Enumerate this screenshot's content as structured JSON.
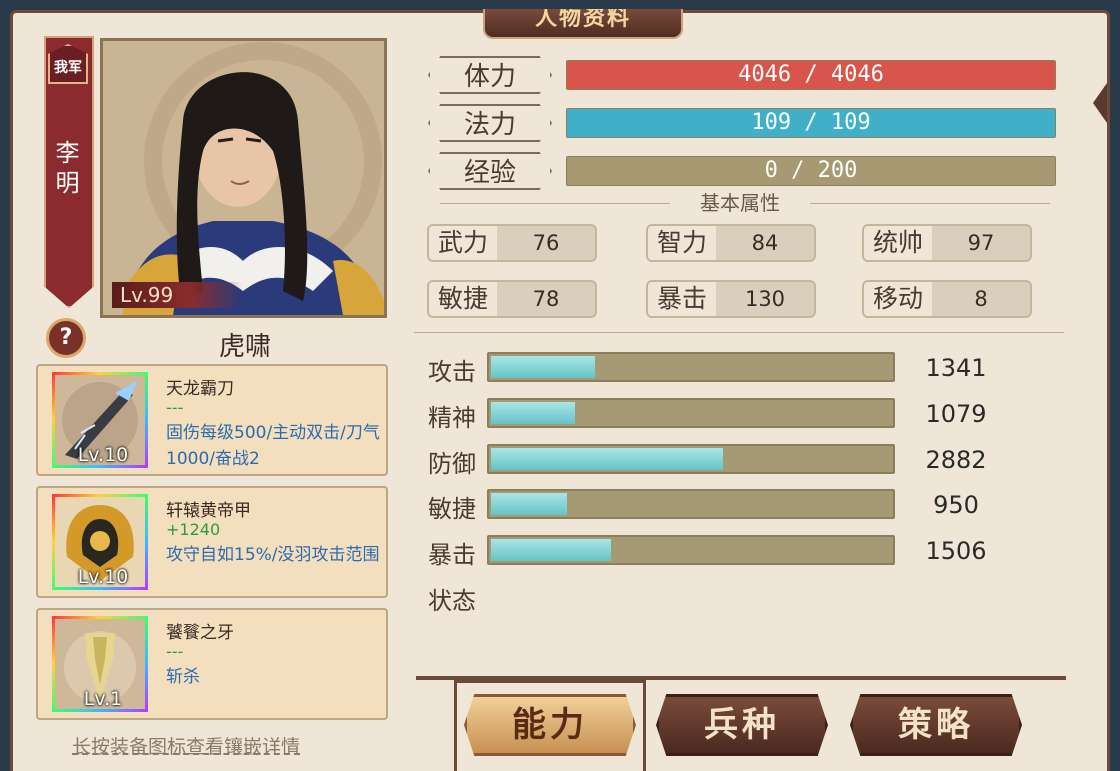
{
  "window": {
    "title": "人物资料"
  },
  "character": {
    "faction": "我军",
    "name": "李明",
    "level": "Lv.99",
    "skill": "虎啸"
  },
  "help": "?",
  "bars": [
    {
      "label": "体力",
      "value": "4046 / 4046",
      "fraction": 1.0,
      "color": "#d9554b"
    },
    {
      "label": "法力",
      "value": "109 / 109",
      "fraction": 1.0,
      "color": "#3fb0c8"
    },
    {
      "label": "经验",
      "value": "0 / 200",
      "fraction": 0.0,
      "color": "#a79a72"
    }
  ],
  "basic_title": "基本属性",
  "attributes": [
    {
      "name": "武力",
      "value": "76"
    },
    {
      "name": "智力",
      "value": "84"
    },
    {
      "name": "统帅",
      "value": "97"
    },
    {
      "name": "敏捷",
      "value": "78"
    },
    {
      "name": "暴击",
      "value": "130"
    },
    {
      "name": "移动",
      "value": "8"
    }
  ],
  "stats": [
    {
      "name": "攻击",
      "value": "1341",
      "fraction": 0.26
    },
    {
      "name": "精神",
      "value": "1079",
      "fraction": 0.21
    },
    {
      "name": "防御",
      "value": "2882",
      "fraction": 0.58
    },
    {
      "name": "敏捷",
      "value": "950",
      "fraction": 0.19
    },
    {
      "name": "暴击",
      "value": "1506",
      "fraction": 0.3
    }
  ],
  "status_label": "状态",
  "equipment": [
    {
      "name": "天龙霸刀",
      "bonus": "---",
      "desc": "固伤每级500/主动双击/刀气1000/奋战2",
      "level": "Lv.10",
      "icon": "blade-icon"
    },
    {
      "name": "轩辕黄帝甲",
      "bonus": "+1240",
      "desc": "攻守自如15%/没羽攻击范围",
      "level": "Lv.10",
      "icon": "armor-icon"
    },
    {
      "name": "饕餮之牙",
      "bonus": "---",
      "desc": "斩杀",
      "level": "Lv.1",
      "icon": "fang-icon"
    }
  ],
  "hint": "长按装备图标查看镶嵌详情",
  "tabs": [
    {
      "label": "能力",
      "active": true
    },
    {
      "label": "兵种",
      "active": false
    },
    {
      "label": "策略",
      "active": false
    }
  ]
}
